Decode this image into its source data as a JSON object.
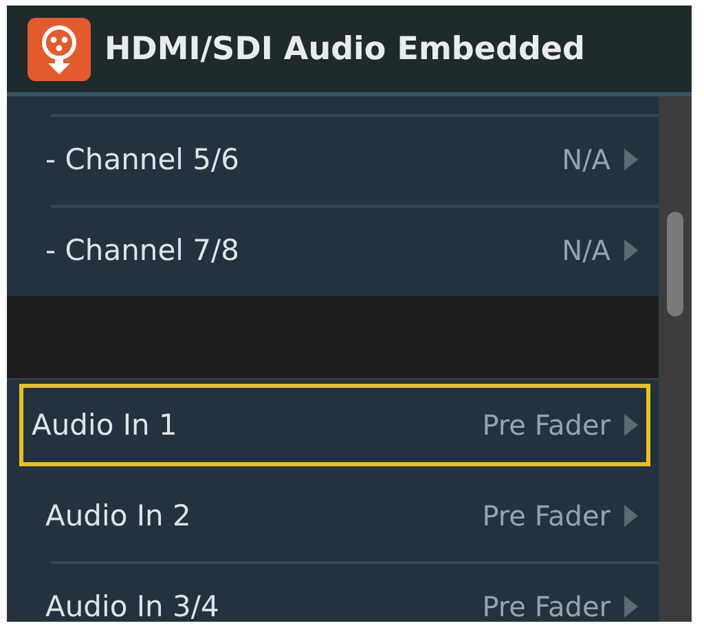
{
  "header": {
    "title": "HDMI/SDI Audio Embedded"
  },
  "items": [
    {
      "kind": "row",
      "label": "- Channel 5/6",
      "value": "N/A",
      "selected": false
    },
    {
      "kind": "row",
      "label": "- Channel 7/8",
      "value": "N/A",
      "selected": false
    },
    {
      "kind": "gap"
    },
    {
      "kind": "row",
      "label": "Audio In 1",
      "value": "Pre Fader",
      "selected": true
    },
    {
      "kind": "row",
      "label": "Audio In 2",
      "value": "Pre Fader",
      "selected": false
    },
    {
      "kind": "row",
      "label": "Audio In 3/4",
      "value": "Pre Fader",
      "selected": false
    }
  ]
}
